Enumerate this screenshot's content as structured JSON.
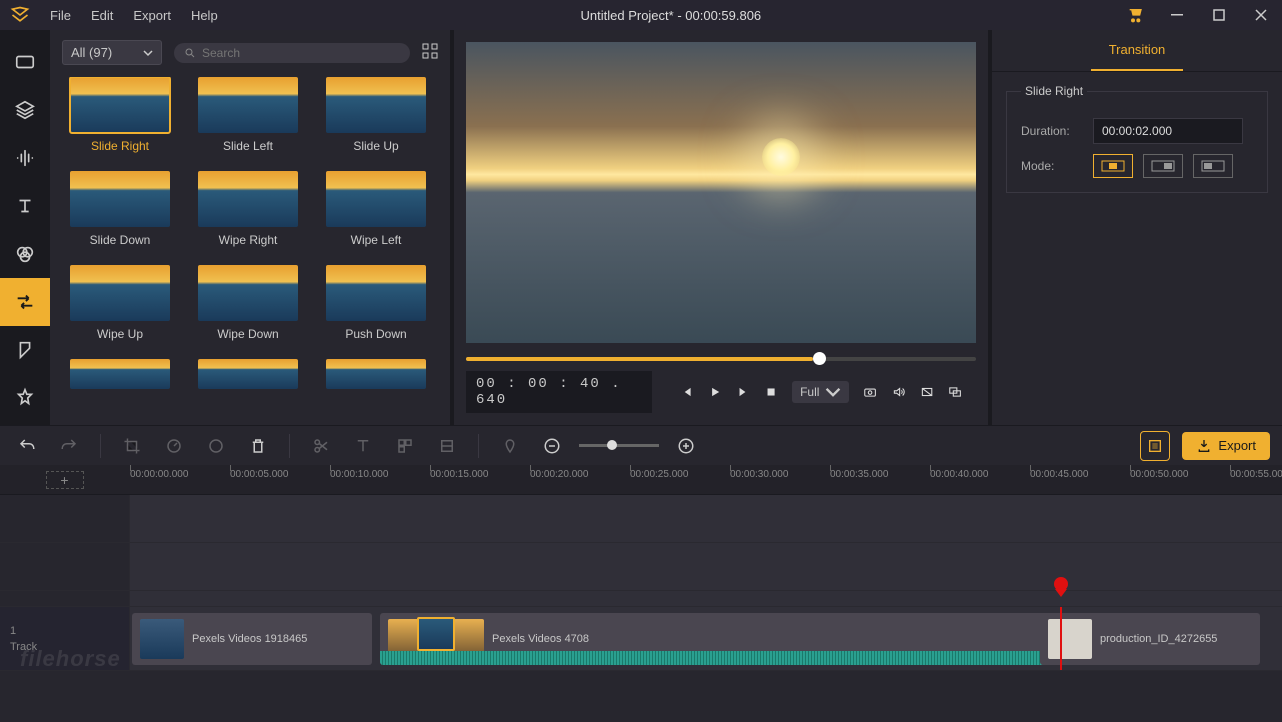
{
  "titlebar": {
    "title": "Untitled Project* - 00:00:59.806",
    "menus": [
      "File",
      "Edit",
      "Export",
      "Help"
    ]
  },
  "library": {
    "filter": "All (97)",
    "search_placeholder": "Search",
    "items": [
      {
        "label": "Slide Right",
        "selected": true
      },
      {
        "label": "Slide Left"
      },
      {
        "label": "Slide Up"
      },
      {
        "label": "Slide Down"
      },
      {
        "label": "Wipe Right"
      },
      {
        "label": "Wipe Left"
      },
      {
        "label": "Wipe Up"
      },
      {
        "label": "Wipe Down"
      },
      {
        "label": "Push Down"
      }
    ],
    "row4": [
      "",
      "",
      ""
    ]
  },
  "preview": {
    "timecode": "00 : 00 : 40 . 640",
    "ratio": "Full"
  },
  "props": {
    "tab": "Transition",
    "name": "Slide Right",
    "duration_label": "Duration:",
    "duration_value": "00:00:02.000",
    "mode_label": "Mode:"
  },
  "toolbar": {
    "export_label": "Export"
  },
  "timeline": {
    "ticks": [
      "00:00:00.000",
      "00:00:05.000",
      "00:00:10.000",
      "00:00:15.000",
      "00:00:20.000",
      "00:00:25.000",
      "00:00:30.000",
      "00:00:35.000",
      "00:00:40.000",
      "00:00:45.000",
      "00:00:50.000",
      "00:00:55.000"
    ],
    "track_index": "1",
    "track_label": "Track",
    "clip1": "Pexels Videos 1918465",
    "clip2": "Pexels Videos 4708",
    "clip3": "production_ID_4272655"
  },
  "watermark": "filehorse"
}
